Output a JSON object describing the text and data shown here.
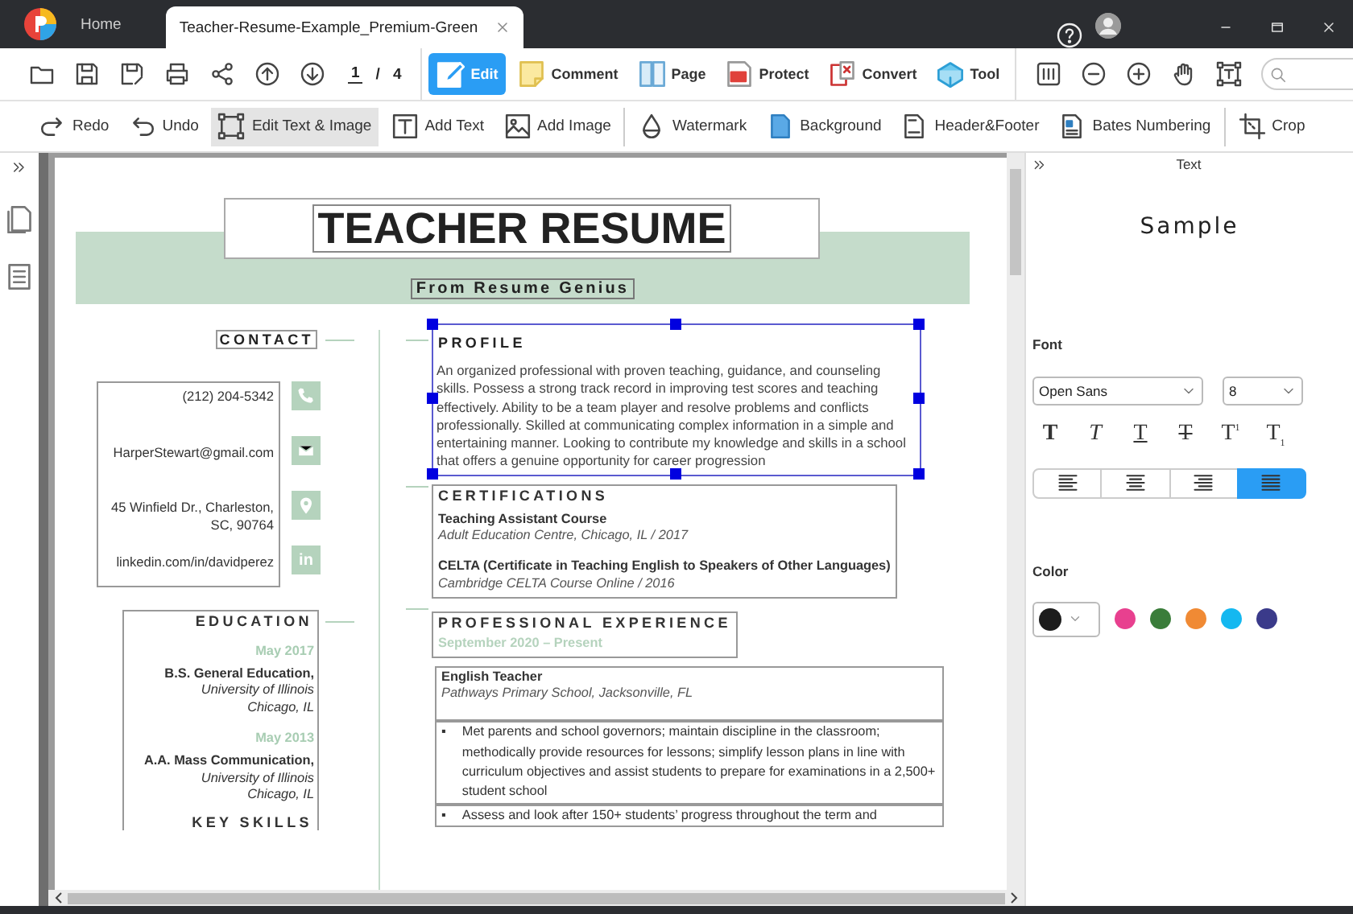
{
  "tabs": [
    {
      "label": "Home",
      "selected": false
    },
    {
      "label": "Teacher-Resume-Example_Premium-Green",
      "selected": true
    }
  ],
  "pager": {
    "current": "1",
    "separator": "/",
    "total": "4"
  },
  "modes": [
    {
      "label": "Edit",
      "selected": true
    },
    {
      "label": "Comment",
      "selected": false
    },
    {
      "label": "Page",
      "selected": false
    },
    {
      "label": "Protect",
      "selected": false
    },
    {
      "label": "Convert",
      "selected": false
    },
    {
      "label": "Tool",
      "selected": false
    }
  ],
  "edit_tools": [
    [
      {
        "label": "Redo",
        "selected": false
      },
      {
        "label": "Undo",
        "selected": false
      },
      {
        "label": "Edit Text & Image",
        "selected": true
      },
      {
        "label": "Add Text",
        "selected": false
      },
      {
        "label": "Add Image",
        "selected": false
      }
    ],
    [
      {
        "label": "Watermark",
        "selected": false
      },
      {
        "label": "Background",
        "selected": false
      },
      {
        "label": "Header&Footer",
        "selected": false
      },
      {
        "label": "Bates Numbering",
        "selected": false
      }
    ],
    [
      {
        "label": "Crop",
        "selected": false
      }
    ]
  ],
  "document": {
    "title": "TEACHER RESUME",
    "subtitle": "From Resume Genius",
    "contact": {
      "heading": "CONTACT",
      "items": [
        {
          "lines": [
            "(212) 204-5342"
          ]
        },
        {
          "lines": [
            "HarperStewart@gmail.com"
          ]
        },
        {
          "lines": [
            "45 Winfield Dr., Charleston,",
            "SC, 90764"
          ]
        },
        {
          "lines": [
            "linkedin.com/in/davidperez"
          ],
          "badge": "in"
        }
      ]
    },
    "education": {
      "heading": "EDUCATION",
      "entries": [
        {
          "date": "May 2017",
          "degree": "B.S. General Education,",
          "school": "University of Illinois",
          "place": "Chicago, IL"
        },
        {
          "date": "May 2013",
          "degree": "A.A. Mass Communication,",
          "school": "University of Illinois",
          "place": "Chicago, IL"
        }
      ]
    },
    "skills_heading": "KEY SKILLS",
    "profile": {
      "heading": "PROFILE",
      "selected": true,
      "text": "An organized professional with proven teaching, guidance, and counseling skills. Possess a strong track record in improving test scores and teaching effectively. Ability to be a team player and resolve problems and conflicts professionally. Skilled at communicating complex information in a simple and entertaining manner. Looking to contribute my knowledge and skills in a school that offers a genuine opportunity for career progression"
    },
    "certifications": {
      "heading": "CERTIFICATIONS",
      "items": [
        {
          "name": "Teaching Assistant Course",
          "detail": "Adult Education Centre, Chicago, IL / 2017"
        },
        {
          "name": "CELTA (Certificate in Teaching English to Speakers of Other Languages)",
          "detail": "Cambridge CELTA Course Online / 2016"
        }
      ]
    },
    "experience": {
      "heading": "PROFESSIONAL EXPERIENCE",
      "date": "September 2020 – Present",
      "jobs": [
        {
          "title": "English Teacher",
          "place": "Pathways Primary School, Jacksonville, FL",
          "bullets": [
            {
              "marker": "▪",
              "text": "Met parents and school governors; maintain discipline in the classroom; methodically provide resources for lessons; simplify lesson plans in line with curriculum objectives and assist students to prepare for examinations in a 2,500+ student school"
            },
            {
              "marker": "▪",
              "text": "Assess and look after 150+ students’ progress throughout the term and"
            }
          ]
        }
      ]
    }
  },
  "panel": {
    "heading": "Text",
    "sample": "Sample",
    "font_label": "Font",
    "font_family": "Open Sans",
    "font_size": "8",
    "styles": [
      {
        "kind": "bold",
        "label": "T"
      },
      {
        "kind": "italic",
        "label": "T"
      },
      {
        "kind": "underline",
        "label": "T"
      },
      {
        "kind": "strikethrough",
        "label": "T"
      },
      {
        "kind": "superscript",
        "label": "T$^{1}$"
      },
      {
        "kind": "subscript",
        "label": "T$_{1}$"
      }
    ],
    "alignments": [
      {
        "kind": "left",
        "selected": false
      },
      {
        "kind": "center",
        "selected": false
      },
      {
        "kind": "right",
        "selected": false
      },
      {
        "kind": "justify",
        "selected": true
      }
    ],
    "color_label": "Color",
    "current": {
      "color": "#1c1c1c"
    },
    "swatches": [
      {
        "color": "#e8408f"
      },
      {
        "color": "#3a7d3a"
      },
      {
        "color": "#f08a34"
      },
      {
        "color": "#14b8f0"
      },
      {
        "color": "#3a3a8a"
      }
    ]
  }
}
